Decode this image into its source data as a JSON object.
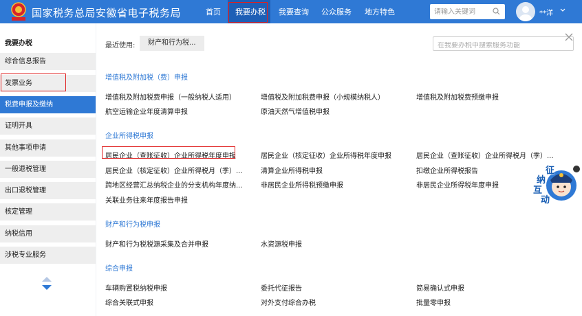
{
  "header": {
    "site_title": "国家税务总局安徽省电子税务局",
    "nav": [
      "首页",
      "我要办税",
      "我要查询",
      "公众服务",
      "地方特色"
    ],
    "search_placeholder": "请输入关键词",
    "user_name": "**洋"
  },
  "sidebar": {
    "title": "我要办税",
    "items": [
      "综合信息报告",
      "发票业务",
      "税费申报及缴纳",
      "证明开具",
      "其他事项申请",
      "一般退税管理",
      "出口退税管理",
      "核定管理",
      "纳税信用",
      "涉税专业服务"
    ],
    "active_index": 2
  },
  "main": {
    "recent_label": "最近使用:",
    "recent_chip": "财产和行为税...",
    "search_placeholder": "在我要办税中搜索服务功能",
    "sections": [
      {
        "title": "增值税及附加税（费）申报",
        "links": [
          "增值税及附加税费申报（一般纳税人适用）",
          "增值税及附加税费申报（小规模纳税人）",
          "增值税及附加税费预缴申报",
          "航空运输企业年度清算申报",
          "原油天然气增值税申报"
        ]
      },
      {
        "title": "企业所得税申报",
        "links": [
          "居民企业（查账征收）企业所得税年度申报",
          "居民企业（核定征收）企业所得税年度申报",
          "居民企业（查账征收）企业所得税月（季）...",
          "居民企业（核定征收）企业所得税月（季）...",
          "清算企业所得税申报",
          "扣缴企业所得税报告",
          "跨地区经营汇总纳税企业的分支机构年度纳...",
          "非居民企业所得税预缴申报",
          "非居民企业所得税年度申报",
          "关联业务往来年度报告申报"
        ]
      },
      {
        "title": "财产和行为税申报",
        "links": [
          "财产和行为税税源采集及合并申报",
          "水资源税申报"
        ]
      },
      {
        "title": "综合申报",
        "links": [
          "车辆购置税纳税申报",
          "委托代征报告",
          "简易确认式申报",
          "综合关联式申报",
          "对外支付综合办税",
          "批量零申报"
        ]
      }
    ]
  },
  "mascot": {
    "chars": [
      "征",
      "纳",
      "互",
      "动"
    ]
  },
  "colors": {
    "brand_blue": "#2f79d5",
    "highlight_red": "#e02020"
  }
}
